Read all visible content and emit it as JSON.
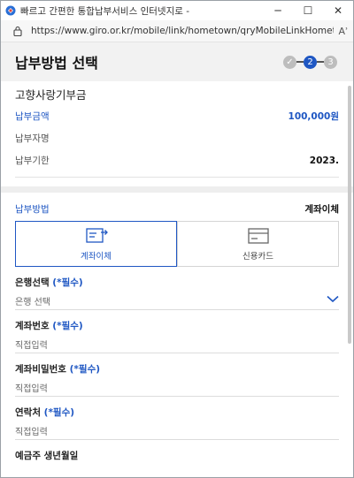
{
  "window": {
    "title": "빠르고 간편한 통합납부서비스 인터넷지로 -",
    "url": "https://www.giro.or.kr/mobile/link/hometown/qryMobileLinkHometownBillDe...",
    "minimize": "─",
    "maximize": "☐",
    "close": "✕",
    "reader": "Aʾ"
  },
  "header": {
    "title": "납부방법 선택",
    "steps": [
      {
        "label": "✓"
      },
      {
        "label": "2"
      },
      {
        "label": "3"
      }
    ]
  },
  "bill": {
    "name": "고향사랑기부금",
    "amount_label": "납부금액",
    "amount_value": "100,000원",
    "payer_label": "납부자명",
    "payer_value": "",
    "due_label": "납부기한",
    "due_value": "2023."
  },
  "payment_method": {
    "label": "납부방법",
    "value": "계좌이체",
    "tabs": [
      {
        "label": "계좌이체",
        "icon": "bank-transfer-icon",
        "active": true
      },
      {
        "label": "신용카드",
        "icon": "credit-card-icon",
        "active": false
      }
    ]
  },
  "form": {
    "bank": {
      "label": "은행선택",
      "required": "(*필수)",
      "value": "은행 선택"
    },
    "account": {
      "label": "계좌번호",
      "required": "(*필수)",
      "placeholder": "직접입력"
    },
    "password": {
      "label": "계좌비밀번호",
      "required": "(*필수)",
      "placeholder": "직접입력"
    },
    "contact": {
      "label": "연락처",
      "required": "(*필수)",
      "placeholder": "직접입력"
    },
    "birth": {
      "label": "예금주 생년월일"
    }
  },
  "colors": {
    "accent": "#1f57c3",
    "header_bg": "#f2f2f2"
  }
}
